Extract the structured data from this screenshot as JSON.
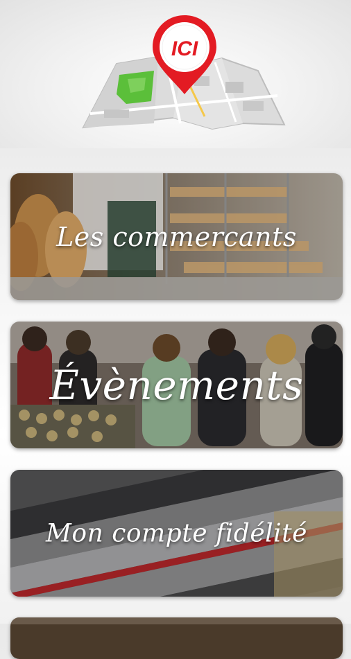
{
  "app": {
    "logo_text": "ICI"
  },
  "menu": {
    "items": [
      {
        "label": "Les commercants"
      },
      {
        "label": "Évènements"
      },
      {
        "label": "Mon compte fidélité"
      }
    ]
  },
  "colors": {
    "brand_red": "#e31b23",
    "map_green": "#5bbf3a",
    "map_gray": "#cfcfcf"
  }
}
